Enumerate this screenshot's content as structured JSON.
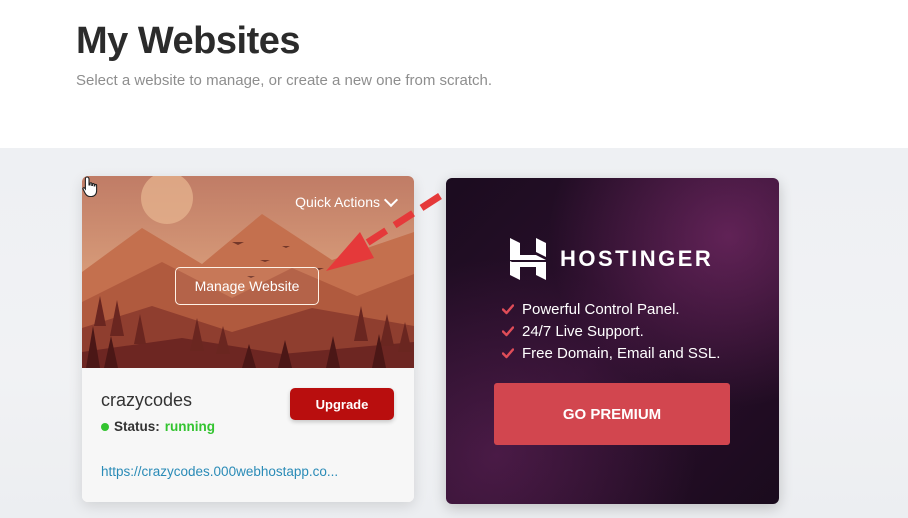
{
  "page": {
    "title": "My Websites",
    "subtitle": "Select a website to manage, or create a new one from scratch."
  },
  "website_card": {
    "quick_actions_label": "Quick Actions",
    "manage_label": "Manage Website",
    "site_name": "crazycodes",
    "status_label": "Status:",
    "status_value": "running",
    "upgrade_label": "Upgrade",
    "url": "https://crazycodes.000webhostapp.co..."
  },
  "promo_card": {
    "brand_name": "HOSTINGER",
    "features": [
      "Powerful Control Panel.",
      "24/7 Live Support.",
      "Free Domain, Email and SSL."
    ],
    "cta_label": "GO PREMIUM"
  },
  "colors": {
    "upgrade_red": "#b90e0e",
    "premium_red": "#d2464f",
    "status_green": "#33c430",
    "link_blue": "#2a8bb7",
    "annotation_red": "#e5393a"
  },
  "icons": [
    "chevron-down-icon",
    "mouse-cursor-icon",
    "status-dot-icon",
    "hostinger-logo-icon",
    "check-icon",
    "annotation-arrow-icon"
  ]
}
